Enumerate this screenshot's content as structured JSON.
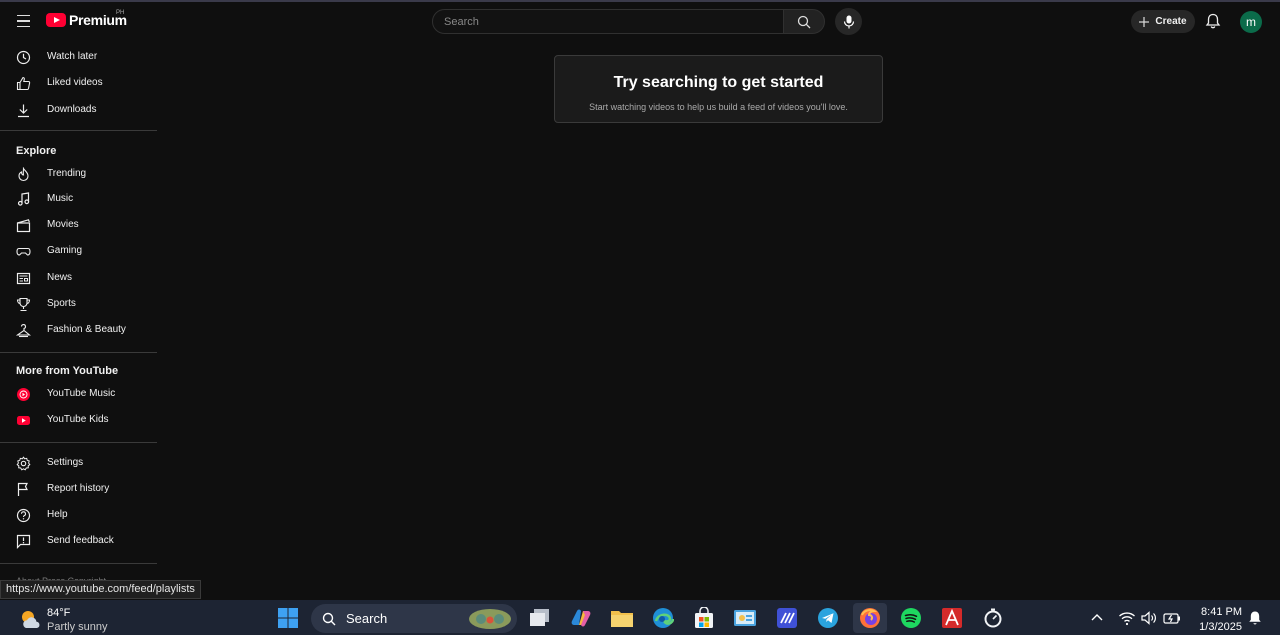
{
  "header": {
    "logo_text": "Premium",
    "country_code": "PH",
    "search_placeholder": "Search",
    "create_label": "Create",
    "avatar_letter": "m"
  },
  "sidebar": {
    "top_items": [
      {
        "label": "Watch later",
        "icon": "clock-icon"
      },
      {
        "label": "Liked videos",
        "icon": "thumbs-up-icon"
      },
      {
        "label": "Downloads",
        "icon": "download-icon"
      }
    ],
    "explore_heading": "Explore",
    "explore_items": [
      {
        "label": "Trending",
        "icon": "fire-icon"
      },
      {
        "label": "Music",
        "icon": "music-note-icon"
      },
      {
        "label": "Movies",
        "icon": "clapperboard-icon"
      },
      {
        "label": "Gaming",
        "icon": "gamepad-icon"
      },
      {
        "label": "News",
        "icon": "newspaper-icon"
      },
      {
        "label": "Sports",
        "icon": "trophy-icon"
      },
      {
        "label": "Fashion & Beauty",
        "icon": "hanger-icon"
      }
    ],
    "more_heading": "More from YouTube",
    "more_items": [
      {
        "label": "YouTube Music",
        "icon": "youtube-music-icon"
      },
      {
        "label": "YouTube Kids",
        "icon": "youtube-kids-icon"
      }
    ],
    "settings_items": [
      {
        "label": "Settings",
        "icon": "gear-icon"
      },
      {
        "label": "Report history",
        "icon": "flag-icon"
      },
      {
        "label": "Help",
        "icon": "help-icon"
      },
      {
        "label": "Send feedback",
        "icon": "feedback-icon"
      }
    ],
    "footer_partial": "About Press Copyright"
  },
  "main": {
    "empty_title": "Try searching to get started",
    "empty_subtitle": "Start watching videos to help us build a feed of videos you'll love."
  },
  "status_url": "https://www.youtube.com/feed/playlists",
  "taskbar": {
    "temperature": "84°F",
    "condition": "Partly sunny",
    "search_label": "Search",
    "time": "8:41 PM",
    "date": "1/3/2025"
  },
  "colors": {
    "background": "#0f0f0f",
    "brand_red": "#ff0033",
    "avatar_green": "#0b6b4a",
    "taskbar": "#1d2433"
  }
}
